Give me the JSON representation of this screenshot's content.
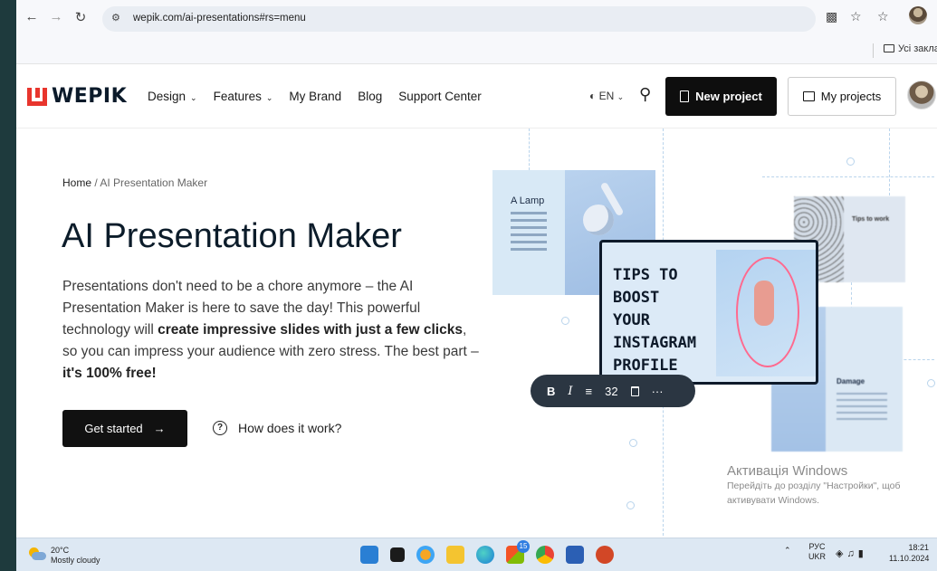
{
  "browser": {
    "url": "wepik.com/ai-presentations#rs=menu",
    "bookmark_folder": "Усі заклад",
    "icons": [
      "back-icon",
      "forward-icon",
      "reload-icon",
      "site-settings-icon",
      "translate-icon",
      "star-icon",
      "bookmark-star-icon"
    ]
  },
  "header": {
    "logo_text": "WEPIK",
    "logo_color": "#e8352d",
    "menu": [
      {
        "label": "Design",
        "dropdown": true
      },
      {
        "label": "Features",
        "dropdown": true
      },
      {
        "label": "My Brand",
        "dropdown": false
      },
      {
        "label": "Blog",
        "dropdown": false
      },
      {
        "label": "Support Center",
        "dropdown": false
      }
    ],
    "lang": "EN",
    "new_project": "New project",
    "my_projects": "My projects"
  },
  "hero": {
    "breadcrumb_home": "Home",
    "breadcrumb_current": "AI Presentation Maker",
    "title": "AI Presentation Maker",
    "desc_1": "Presentations don't need to be a chore anymore – the AI Presentation Maker is here to save the day! This powerful technology will ",
    "desc_bold_1": "create impressive slides with just a few clicks",
    "desc_2": ", so you can impress your audience with zero stress. The best part – ",
    "desc_bold_2": "it's 100% free!",
    "cta": "Get started",
    "how": "How does it work?"
  },
  "illustration": {
    "card_lamp_title": "A Lamp",
    "card_ig_text": [
      "TIPS TO",
      "BOOST",
      "YOUR",
      "INSTAGRAM",
      "PROFILE"
    ],
    "card_tip_title": "Tips to work",
    "card_dmg_title": "Damage",
    "toolbar": {
      "bold": "B",
      "italic": "I",
      "align": "≡",
      "size": "32",
      "more": "···"
    }
  },
  "watermark": {
    "title": "Активація Windows",
    "sub": "Перейдіть до розділу \"Настройки\", щоб активувати Windows."
  },
  "taskbar": {
    "temp": "20°C",
    "weather": "Mostly cloudy",
    "badge": "15",
    "lang_1": "РУС",
    "lang_2": "UKR",
    "time": "18:21",
    "date": "11.10.2024"
  }
}
